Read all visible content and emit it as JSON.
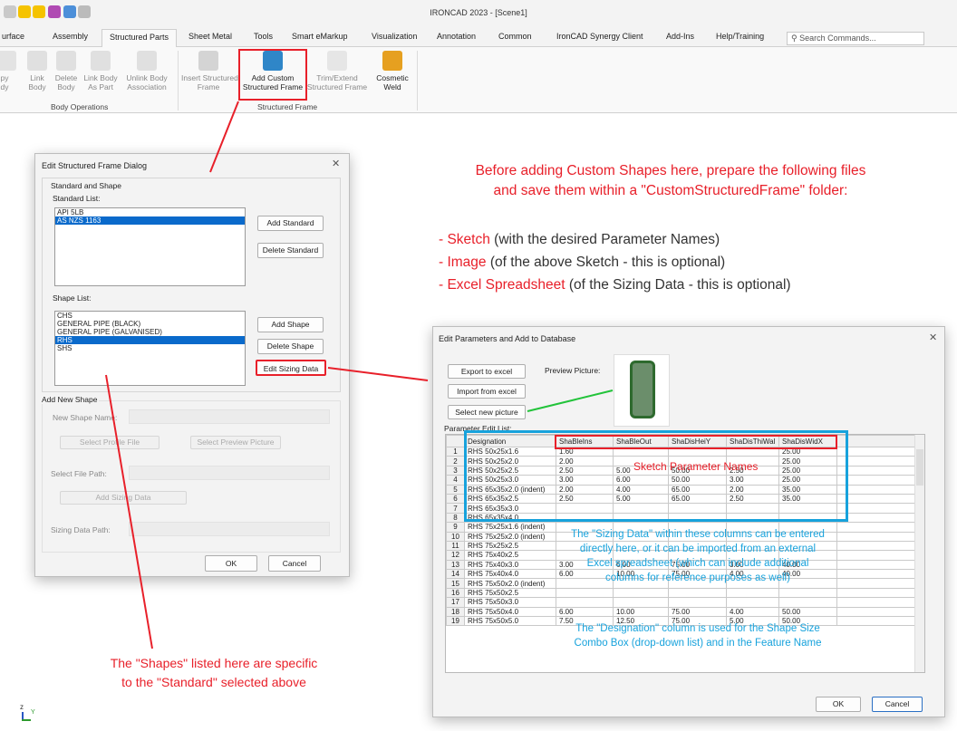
{
  "app": {
    "title": "IRONCAD 2023 - [Scene1]"
  },
  "tabs": [
    "urface",
    "Assembly",
    "Structured Parts",
    "Sheet Metal",
    "Tools",
    "Smart eMarkup",
    "Visualization",
    "Annotation",
    "Common",
    "IronCAD Synergy Client",
    "Add-Ins",
    "Help/Training"
  ],
  "search": {
    "placeholder": "Search Commands..."
  },
  "ribbon": {
    "b1": {
      "l1": "py",
      "l2": "dy"
    },
    "b2": {
      "l1": "Link",
      "l2": "Body"
    },
    "b3": {
      "l1": "Delete",
      "l2": "Body"
    },
    "b4": {
      "l1": "Link Body",
      "l2": "As Part"
    },
    "b5": {
      "l1": "Unlink Body",
      "l2": "Association"
    },
    "b6": {
      "l1": "Insert Structured",
      "l2": "Frame"
    },
    "b7": {
      "l1": "Add Custom",
      "l2": "Structured Frame"
    },
    "b8": {
      "l1": "Trim/Extend",
      "l2": "Structured Frame"
    },
    "b9": {
      "l1": "Cosmetic",
      "l2": "Weld"
    },
    "group1": "Body Operations",
    "group2": "Structured Frame"
  },
  "dialog1": {
    "title": "Edit Structured Frame Dialog",
    "group_label": "Standard and Shape",
    "standard_list_label": "Standard List:",
    "standards": [
      "API 5LB",
      "AS NZS 1163"
    ],
    "add_standard": "Add Standard",
    "delete_standard": "Delete Standard",
    "shape_list_label": "Shape List:",
    "shapes": [
      "CHS",
      "GENERAL PIPE (BLACK)",
      "GENERAL PIPE (GALVANISED)",
      "RHS",
      "SHS"
    ],
    "add_shape": "Add Shape",
    "delete_shape": "Delete Shape",
    "edit_sizing": "Edit Sizing Data",
    "add_new_group": "Add New Shape",
    "new_shape_name": "New Shape Name:",
    "select_profile": "Select Profile File",
    "select_preview": "Select Preview Picture",
    "select_file_path": "Select File Path:",
    "add_sizing": "Add Sizing Data",
    "sizing_path": "Sizing Data Path:",
    "ok": "OK",
    "cancel": "Cancel"
  },
  "dialog2": {
    "title": "Edit Parameters and Add to Database",
    "export": "Export to excel",
    "import": "Import from excel",
    "select_pic": "Select new picture",
    "preview_label": "Preview Picture:",
    "param_label": "Parameter Edit List:",
    "ok": "OK",
    "cancel": "Cancel"
  },
  "table": {
    "columns": [
      "Designation",
      "ShaBleIns",
      "ShaBleOut",
      "ShaDisHeiY",
      "ShaDisThiWal",
      "ShaDisWidX"
    ],
    "rows": [
      [
        "1",
        "RHS 50x25x1.6",
        "1.60",
        "",
        "",
        "",
        "25.00"
      ],
      [
        "2",
        "RHS 50x25x2.0",
        "2.00",
        "",
        "",
        "",
        "25.00"
      ],
      [
        "3",
        "RHS 50x25x2.5",
        "2.50",
        "5.00",
        "50.00",
        "2.50",
        "25.00"
      ],
      [
        "4",
        "RHS 50x25x3.0",
        "3.00",
        "6.00",
        "50.00",
        "3.00",
        "25.00"
      ],
      [
        "5",
        "RHS 65x35x2.0 (indent)",
        "2.00",
        "4.00",
        "65.00",
        "2.00",
        "35.00"
      ],
      [
        "6",
        "RHS 65x35x2.5",
        "2.50",
        "5.00",
        "65.00",
        "2.50",
        "35.00"
      ],
      [
        "7",
        "RHS 65x35x3.0",
        "",
        "",
        "",
        "",
        ""
      ],
      [
        "8",
        "RHS 65x35x4.0",
        "",
        "",
        "",
        "",
        ""
      ],
      [
        "9",
        "RHS 75x25x1.6 (indent)",
        "",
        "",
        "",
        "",
        ""
      ],
      [
        "10",
        "RHS 75x25x2.0 (indent)",
        "",
        "",
        "",
        "",
        ""
      ],
      [
        "11",
        "RHS 75x25x2.5",
        "",
        "",
        "",
        "",
        ""
      ],
      [
        "12",
        "RHS 75x40x2.5",
        "",
        "",
        "",
        "",
        ""
      ],
      [
        "13",
        "RHS 75x40x3.0",
        "3.00",
        "6.00",
        "75.00",
        "3.00",
        "40.00"
      ],
      [
        "14",
        "RHS 75x40x4.0",
        "6.00",
        "10.00",
        "75.00",
        "4.00",
        "40.00"
      ],
      [
        "15",
        "RHS 75x50x2.0 (indent)",
        "",
        "",
        "",
        "",
        ""
      ],
      [
        "16",
        "RHS 75x50x2.5",
        "",
        "",
        "",
        "",
        ""
      ],
      [
        "17",
        "RHS 75x50x3.0",
        "",
        "",
        "",
        "",
        ""
      ],
      [
        "18",
        "RHS 75x50x4.0",
        "6.00",
        "10.00",
        "75.00",
        "4.00",
        "50.00"
      ],
      [
        "19",
        "RHS 75x50x5.0",
        "7.50",
        "12.50",
        "75.00",
        "5.00",
        "50.00"
      ]
    ]
  },
  "annotations": {
    "top1": "Before adding Custom Shapes here, prepare the following files",
    "top2": "and save them within a \"CustomStructuredFrame\" folder:",
    "l1_red": "- Sketch",
    "l1_rest": " (with the desired Parameter Names)",
    "l2_red": "- Image",
    "l2_rest": " (of the above Sketch - this is optional)",
    "l3_red": "- Excel Spreadsheet",
    "l3_rest": " (of the Sizing Data - this is optional)",
    "sketch_names": "Sketch Parameter Names",
    "sizing1": "The \"Sizing Data\" within these columns can be entered",
    "sizing2": "directly here, or it can be imported from an external",
    "sizing3": "Excel spreadsheet (which can include additional",
    "sizing4": "columns for reference purposes as well)",
    "desig1": "The \"Designation\" column is used for the Shape Size",
    "desig2": "Combo Box (drop-down list) and in the Feature Name",
    "shapes1": "The \"Shapes\" listed here are specific",
    "shapes2": "to the \"Standard\" selected above"
  },
  "axes": {
    "z": "z",
    "y": "Y"
  },
  "colors": {
    "annotation_red": "#e8202a",
    "annotation_cyan": "#17a2dc",
    "selection": "#0a6acb",
    "arrow_green": "#22c33a"
  }
}
